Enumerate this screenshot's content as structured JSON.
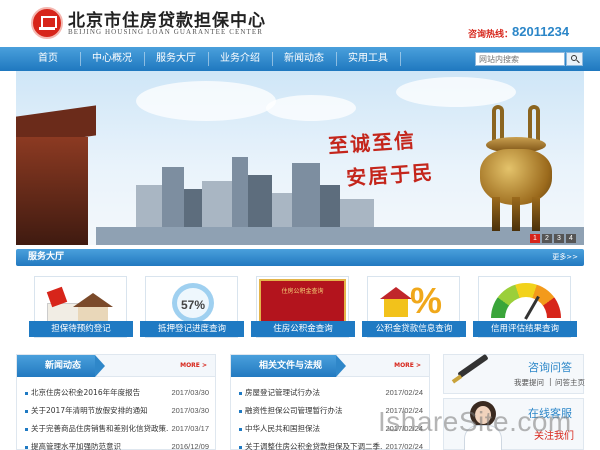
{
  "header": {
    "logo_cn": "北京市住房贷款担保中心",
    "logo_en": "BEIJING HOUSING LOAN GUARANTEE CENTER",
    "hotline_label": "咨询热线：",
    "hotline_number": "82011234"
  },
  "nav": {
    "items": [
      "首页",
      "中心概况",
      "服务大厅",
      "业务介绍",
      "新闻动态",
      "实用工具"
    ],
    "search_placeholder": "网站内搜索"
  },
  "banner": {
    "slogan_line1": "至诚至信",
    "slogan_line2": "安居于民",
    "pages": [
      "1",
      "2",
      "3",
      "4"
    ],
    "active_page": 1
  },
  "services": {
    "title": "服务大厅",
    "more": "更多>>",
    "progress_percent": "57%",
    "certificate_text": "住房公积金查询",
    "items": [
      {
        "label": "担保待预约登记",
        "icon": "house-calculator-icon"
      },
      {
        "label": "抵押登记进度查询",
        "icon": "progress-meter-icon"
      },
      {
        "label": "住房公积金查询",
        "icon": "certificate-icon"
      },
      {
        "label": "公积金贷款信息查询",
        "icon": "house-percent-icon"
      },
      {
        "label": "信用评估结果查询",
        "icon": "credit-gauge-icon"
      }
    ]
  },
  "news": {
    "title": "新闻动态",
    "more": "MORE >",
    "rows": [
      {
        "title": "北京住房公积金2016年年度报告",
        "date": "2017/03/30"
      },
      {
        "title": "关于2017年清明节放假安排的通知",
        "date": "2017/03/30"
      },
      {
        "title": "关于完善商品住房销售和差别化信贷政策...",
        "date": "2017/03/17"
      },
      {
        "title": "提高管理水平加强防范意识",
        "date": "2016/12/09"
      }
    ]
  },
  "laws": {
    "title": "相关文件与法规",
    "more": "MORE >",
    "rows": [
      {
        "title": "房屋登记管理试行办法",
        "date": "2017/02/24"
      },
      {
        "title": "融资性担保公司管理暂行办法",
        "date": "2017/02/24"
      },
      {
        "title": "中华人民共和国担保法",
        "date": "2017/02/24"
      },
      {
        "title": "关于调整住房公积金贷款担保及下调二季...",
        "date": "2017/02/24"
      }
    ]
  },
  "side": {
    "consult_title": "咨询问答",
    "consult_ask": "我要提问",
    "consult_sep": "|",
    "consult_view": "问答主页",
    "service_title": "在线客服",
    "service_sub": "关注我们"
  },
  "watermark": "IshareSite.com",
  "colors": {
    "brand_blue": "#1f7ac3",
    "nav_blue": "#4aa0dc",
    "accent_red": "#d7251a"
  }
}
